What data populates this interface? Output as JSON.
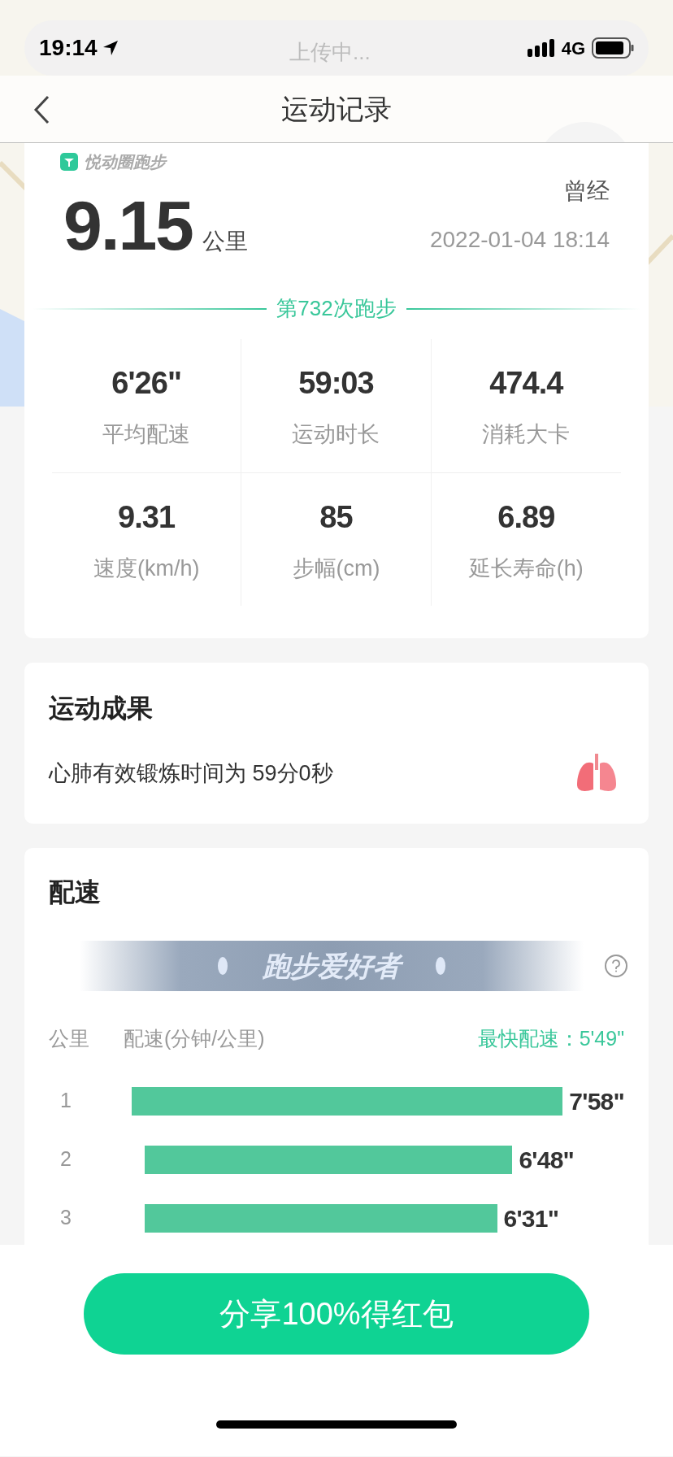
{
  "status_bar": {
    "time": "19:14",
    "upload_text": "上传中...",
    "network": "4G"
  },
  "nav": {
    "title": "运动记录"
  },
  "summary": {
    "brand": "悦动圈跑步",
    "distance": "9.15",
    "unit": "公里",
    "user": "曾经",
    "datetime": "2022-01-04 18:14",
    "run_count": "第732次跑步",
    "stats": [
      {
        "value": "6'26\"",
        "label": "平均配速"
      },
      {
        "value": "59:03",
        "label": "运动时长"
      },
      {
        "value": "474.4",
        "label": "消耗大卡"
      },
      {
        "value": "9.31",
        "label": "速度(km/h)"
      },
      {
        "value": "85",
        "label": "步幅(cm)"
      },
      {
        "value": "6.89",
        "label": "延长寿命(h)"
      }
    ]
  },
  "result": {
    "title": "运动成果",
    "text": "心肺有效锻炼时间为 59分0秒"
  },
  "pace": {
    "title": "配速",
    "badge": "跑步爱好者",
    "col_km": "公里",
    "col_pace": "配速(分钟/公里)",
    "fastest": "最快配速：5'49\"",
    "rows": [
      {
        "km": "1",
        "pace": "7'58\""
      },
      {
        "km": "2",
        "pace": "6'48\""
      },
      {
        "km": "3",
        "pace": "6'31\""
      }
    ]
  },
  "share_button": "分享100%得红包"
}
